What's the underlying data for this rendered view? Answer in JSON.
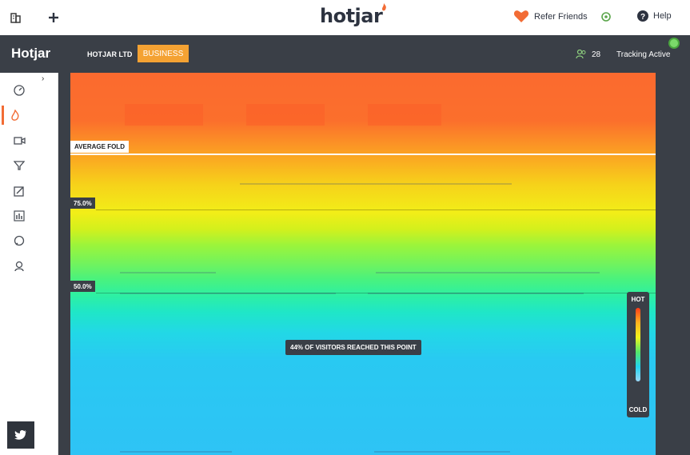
{
  "topbar": {
    "logo_text": "hotjar",
    "refer_label": "Refer Friends",
    "help_label": "Help"
  },
  "app_header": {
    "brand": "Hotjar",
    "org_name": "HOTJAR LTD",
    "plan_badge": "BUSINESS",
    "user_count": "28",
    "tracking_status": "Tracking Active",
    "tracking_color": "#7bd96a"
  },
  "sidebar": {
    "items": [
      {
        "icon": "dashboard-icon",
        "active": false
      },
      {
        "icon": "heatmap-flame-icon",
        "active": true
      },
      {
        "icon": "recordings-camera-icon",
        "active": false
      },
      {
        "icon": "funnel-icon",
        "active": false
      },
      {
        "icon": "forms-edit-icon",
        "active": false
      },
      {
        "icon": "reports-bar-chart-icon",
        "active": false
      },
      {
        "icon": "polls-chat-icon",
        "active": false
      },
      {
        "icon": "user-feedback-icon",
        "active": false
      }
    ],
    "social_icon": "twitter-icon"
  },
  "heatmap": {
    "average_fold_label": "AVERAGE FOLD",
    "markers": [
      {
        "label": "75.0%"
      },
      {
        "label": "50.0%"
      }
    ],
    "reach_label": "44% OF VISITORS REACHED THIS POINT",
    "legend": {
      "hot": "HOT",
      "cold": "COLD"
    },
    "colors": {
      "hot": "#fb6a2f",
      "warm": "#f2ee18",
      "mid": "#6ff35f",
      "cold": "#2ec3f5",
      "accent": "#f26c35"
    }
  }
}
